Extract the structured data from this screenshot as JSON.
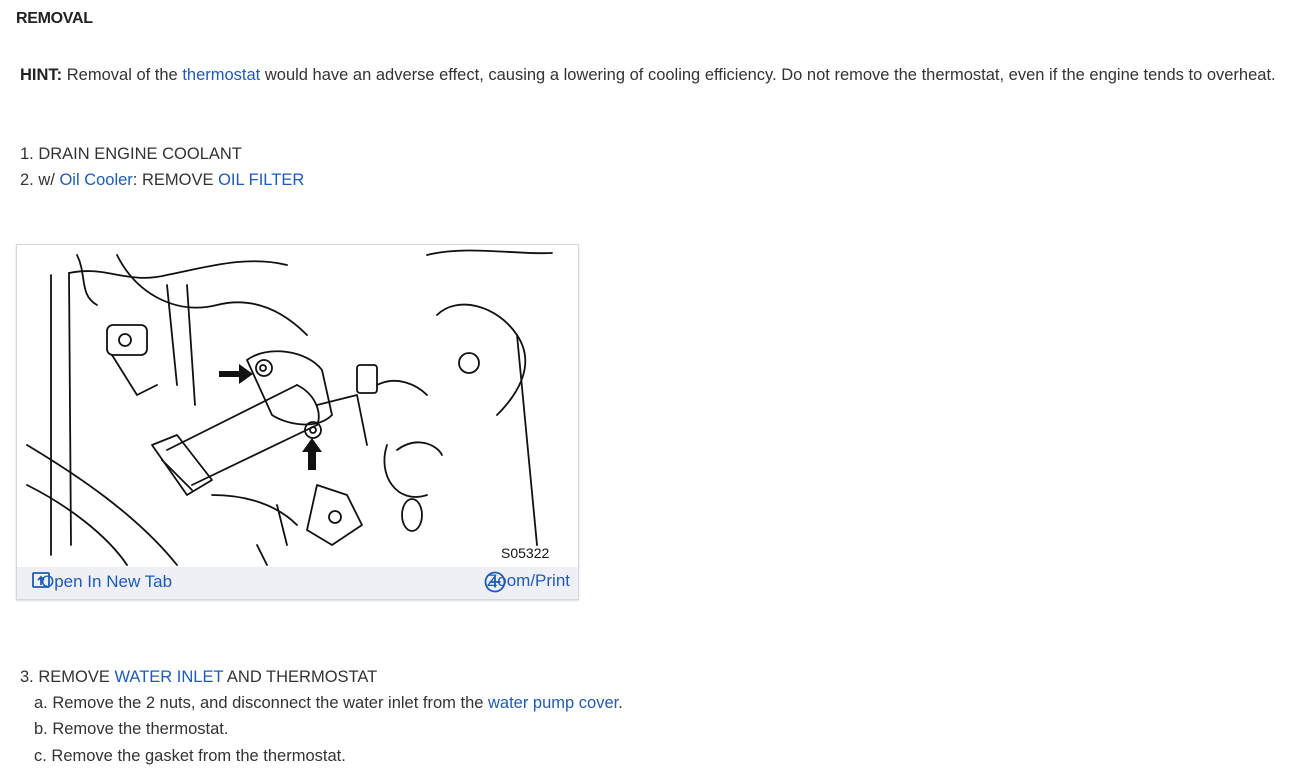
{
  "section": {
    "heading": "REMOVAL"
  },
  "hint": {
    "label": "HINT:",
    "text_before": " Removal of the ",
    "link": "thermostat",
    "text_after": " would have an adverse effect, causing a lowering of cooling efficiency. Do not remove the thermostat, even if the engine tends to overheat."
  },
  "steps": {
    "step1": {
      "text": "1. DRAIN ENGINE COOLANT"
    },
    "step2": {
      "prefix": "2. w/ ",
      "link1": "Oil Cooler",
      "mid": ": REMOVE ",
      "link2": "OIL FILTER"
    },
    "step3": {
      "prefix": "3. REMOVE ",
      "link": "WATER INLET",
      "suffix": " AND THERMOSTAT"
    },
    "step3a": {
      "prefix": "a. Remove the 2 nuts, and disconnect the water inlet from the ",
      "link": "water pump cover",
      "suffix": "."
    },
    "step3b": {
      "text": "b. Remove the thermostat."
    },
    "step3c": {
      "text": "c. Remove the gasket from the thermostat."
    }
  },
  "figure": {
    "code": "S05322",
    "open_label": "Open In New Tab",
    "zoom_label": "Zoom/Print",
    "icons": {
      "open": "open-new-tab-icon",
      "zoom": "zoom-plus-icon"
    }
  },
  "colors": {
    "link": "#1f5bb5",
    "text": "#333333",
    "bar": "#eef0f6"
  }
}
